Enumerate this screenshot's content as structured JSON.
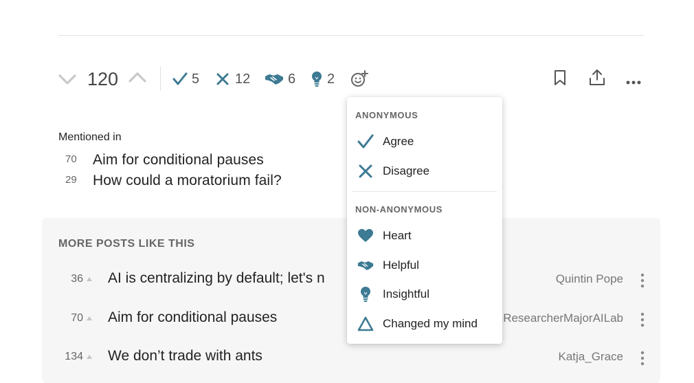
{
  "vote": {
    "score": "120"
  },
  "reactions": {
    "agree": "5",
    "disagree": "12",
    "helpful": "6",
    "insightful": "2"
  },
  "colors": {
    "accent": "#3d7a93"
  },
  "mentioned": {
    "title": "Mentioned in",
    "items": [
      {
        "score": "70",
        "title": "Aim for conditional pauses"
      },
      {
        "score": "29",
        "title": "How could a moratorium fail?"
      }
    ]
  },
  "more_posts": {
    "title": "MORE POSTS LIKE THIS",
    "items": [
      {
        "score": "36",
        "title": "AI is centralizing by default; let's n",
        "author": "Quintin Pope"
      },
      {
        "score": "70",
        "title": "Aim for conditional pauses",
        "author": "ResearcherMajorAILab"
      },
      {
        "score": "134",
        "title": "We don’t trade with ants",
        "author": "Katja_Grace"
      }
    ]
  },
  "reaction_menu": {
    "anonymous_label": "ANONYMOUS",
    "agree": "Agree",
    "disagree": "Disagree",
    "nonanonymous_label": "NON-ANONYMOUS",
    "heart": "Heart",
    "helpful": "Helpful",
    "insightful": "Insightful",
    "changed_mind": "Changed my mind"
  }
}
